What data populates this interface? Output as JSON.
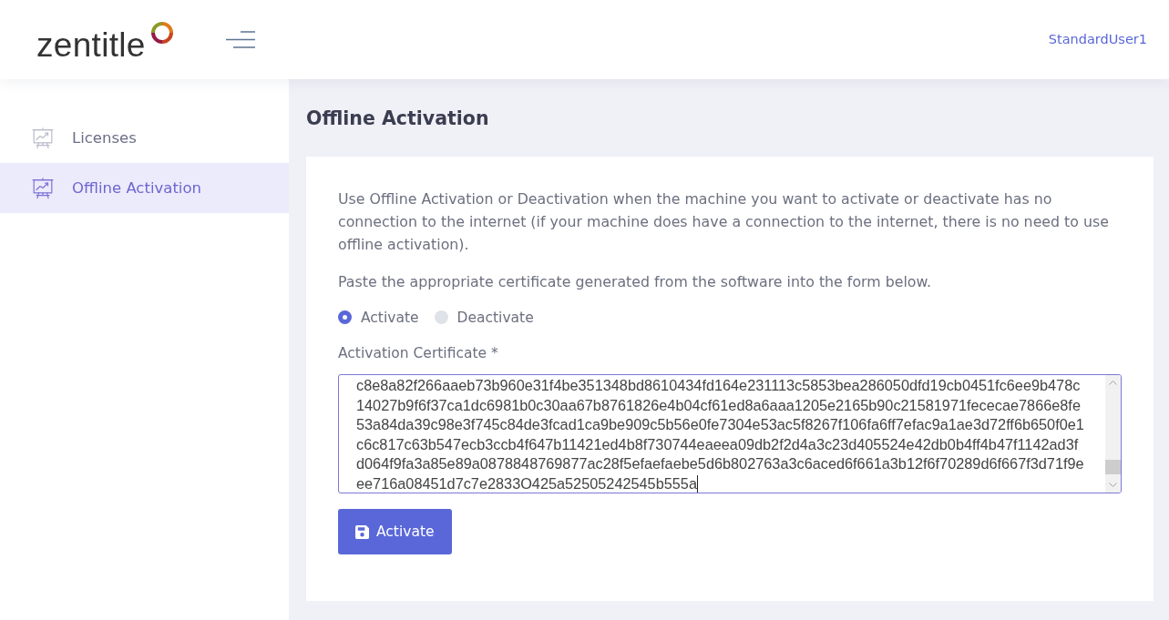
{
  "header": {
    "logo": "zentitle",
    "user": "StandardUser1"
  },
  "sidebar": {
    "items": [
      {
        "label": "Licenses",
        "selected": false
      },
      {
        "label": "Offline Activation",
        "selected": true
      }
    ]
  },
  "page": {
    "title": "Offline Activation"
  },
  "card": {
    "paragraphs": [
      "Use Offline Activation or Deactivation when the machine you want to activate or deactivate has no connection to the internet (if your machine does have a connection to the internet, there is no need to use offline activation).",
      "Paste the appropriate certificate generated from the software into the form below."
    ],
    "mode_options": [
      {
        "label": "Activate",
        "selected": true
      },
      {
        "label": "Deactivate",
        "selected": false
      }
    ],
    "certificate": {
      "label": "Activation Certificate *",
      "lines": [
        "c8e8a82f266aaeb73b960e31f4be351348bd8610434fd164e231113c5853bea286050dfd19cb0451fc6ee9b478c",
        "14027b9f6f37ca1dc6981b0c30aa67b8761826e4b04cf61ed8a6aaa1205e2165b90c21581971fececae7866e8fe",
        "53a84da39c98e3f745c84de3fcad1ca9be909c5b56e0fe7304e53ac5f8267f106fa6ff7efac9a1ae3d72ff6b650f0e1",
        "c6c817c63b547ecb3ccb4f647b11421ed4b8f730744eaeea09db2f2d4a3c23d405524e42db0b4ff4b47f1142ad3f",
        "d064f9fa3a85e89a0878848769877ac28f5efaefaebe5d6b802763a3c6aced6f661a3b12f6f70289d6f667f3d71f9e",
        "ee716a08451d7c7e2833O425a52505242545b555a"
      ]
    },
    "submit_button": "Activate"
  }
}
